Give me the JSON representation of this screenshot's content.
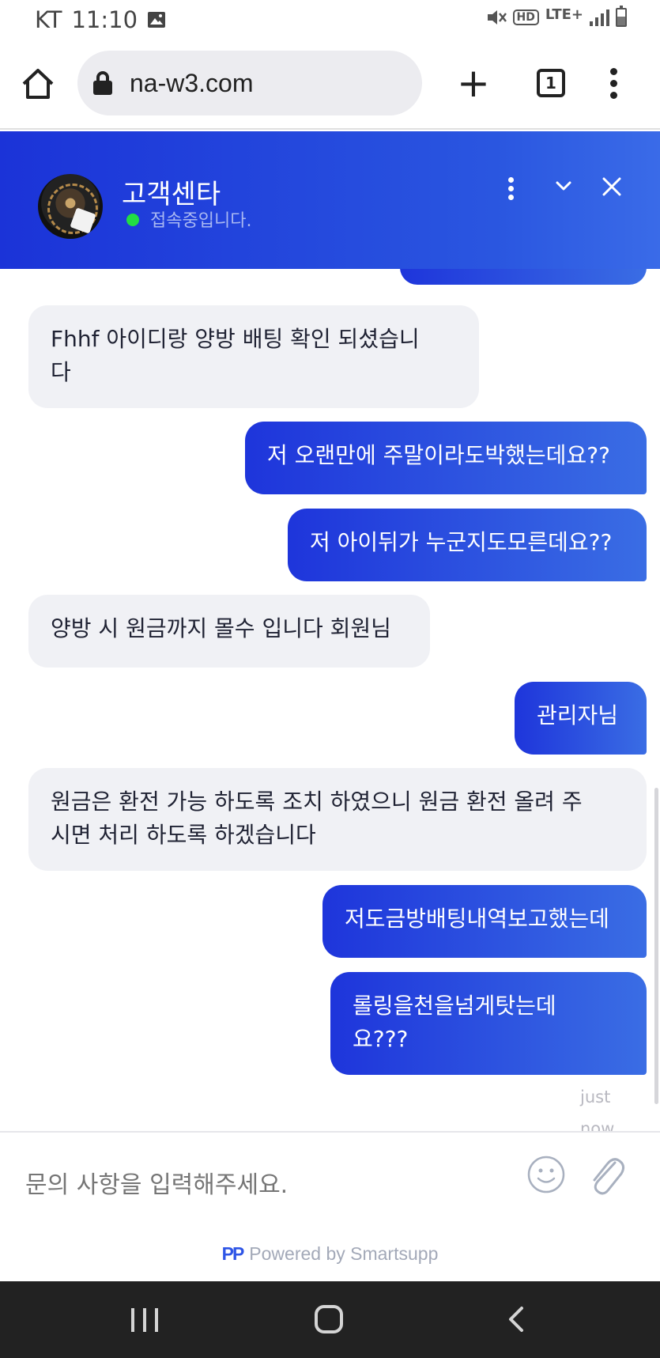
{
  "status_bar": {
    "carrier": "KT",
    "time": "11:10",
    "network": "LTE+",
    "hd": "HD"
  },
  "browser": {
    "url": "na-w3.com",
    "tab_count": "1"
  },
  "chat_header": {
    "title": "고객센타",
    "status": "접속중입니다."
  },
  "messages": [
    {
      "sender": "agent",
      "text": "Fhhf 아이디랑 양방 배팅 확인 되셨습니\n다"
    },
    {
      "sender": "user",
      "text": "저 오랜만에 주말이라도박했는데요??"
    },
    {
      "sender": "user",
      "text": "저 아이뒤가 누군지도모른데요??"
    },
    {
      "sender": "agent",
      "text": "양방 시 원금까지 몰수 입니다 회원님"
    },
    {
      "sender": "user",
      "text": "관리자님"
    },
    {
      "sender": "agent",
      "text": "원금은 환전 가능 하도록 조치 하였으니 원금 환전 올려 주\n시면 처리 하도록 하겠습니다"
    },
    {
      "sender": "user",
      "text": "저도금방배팅내역보고했는데"
    },
    {
      "sender": "user",
      "text": "롤링을천을넘게탓는데\n요???"
    }
  ],
  "last_message_time": "just now",
  "composer": {
    "placeholder": "문의 사항을 입력해주세요."
  },
  "footer": {
    "logo": "PP",
    "powered_by": "Powered by Smartsupp"
  },
  "colors": {
    "header_gradient_start": "#1b33d8",
    "header_gradient_end": "#3a6be8",
    "user_bubble": "#1e35db",
    "agent_bubble": "#f0f1f5",
    "online_dot": "#22dd44"
  }
}
